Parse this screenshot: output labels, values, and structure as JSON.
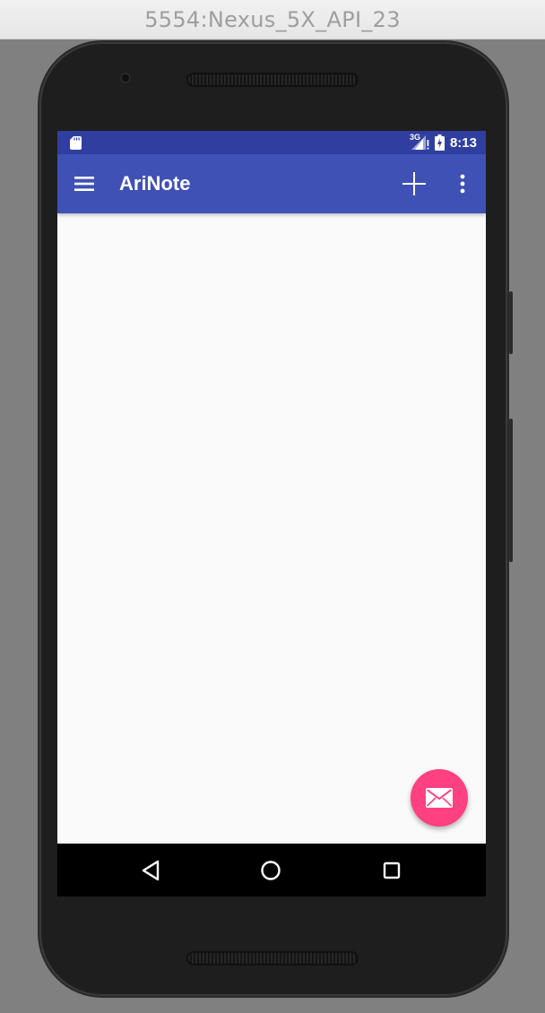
{
  "window": {
    "title": "5554:Nexus_5X_API_23"
  },
  "status_bar": {
    "network_label": "3G",
    "time": "8:13",
    "icons": [
      "sd-card-icon",
      "signal-icon",
      "battery-icon"
    ],
    "color": "#303f9f"
  },
  "app_bar": {
    "title": "AriNote",
    "color": "#3f51b5",
    "icons": [
      "menu-icon",
      "add-icon",
      "overflow-menu-icon"
    ]
  },
  "fab": {
    "icon": "email-icon",
    "color": "#ff4081"
  },
  "nav_bar": {
    "icons": [
      "back-icon",
      "home-icon",
      "recents-icon"
    ]
  }
}
